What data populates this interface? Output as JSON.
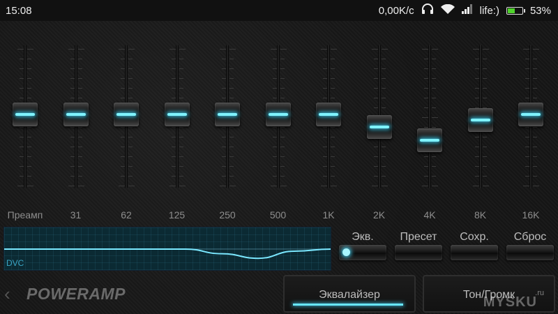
{
  "status_bar": {
    "time": "15:08",
    "network_speed": "0,00K/с",
    "carrier": "life:)",
    "battery_percent": "53%",
    "battery_level": 0.53,
    "icons": [
      "headphones-icon",
      "wifi-icon",
      "signal-icon",
      "battery-icon"
    ]
  },
  "equalizer": {
    "bands": [
      {
        "label": "Преамп",
        "level": 0.52
      },
      {
        "label": "31",
        "level": 0.52
      },
      {
        "label": "62",
        "level": 0.52
      },
      {
        "label": "125",
        "level": 0.52
      },
      {
        "label": "250",
        "level": 0.52
      },
      {
        "label": "500",
        "level": 0.52
      },
      {
        "label": "1K",
        "level": 0.52
      },
      {
        "label": "2K",
        "level": 0.41
      },
      {
        "label": "4K",
        "level": 0.3
      },
      {
        "label": "8K",
        "level": 0.47
      },
      {
        "label": "16K",
        "level": 0.52
      }
    ],
    "accent_color": "#68e6ff"
  },
  "curve_panel": {
    "label": "DVC"
  },
  "controls": {
    "eq_label": "Экв.",
    "eq_enabled": true,
    "preset_label": "Пресет",
    "save_label": "Сохр.",
    "reset_label": "Сброс"
  },
  "bottom": {
    "logo": "POWERAMP",
    "tab_equalizer": "Эквалайзер",
    "tab_tone": "Тон/Громк",
    "watermark": "MYSKU",
    "watermark_suffix": ".ru"
  }
}
